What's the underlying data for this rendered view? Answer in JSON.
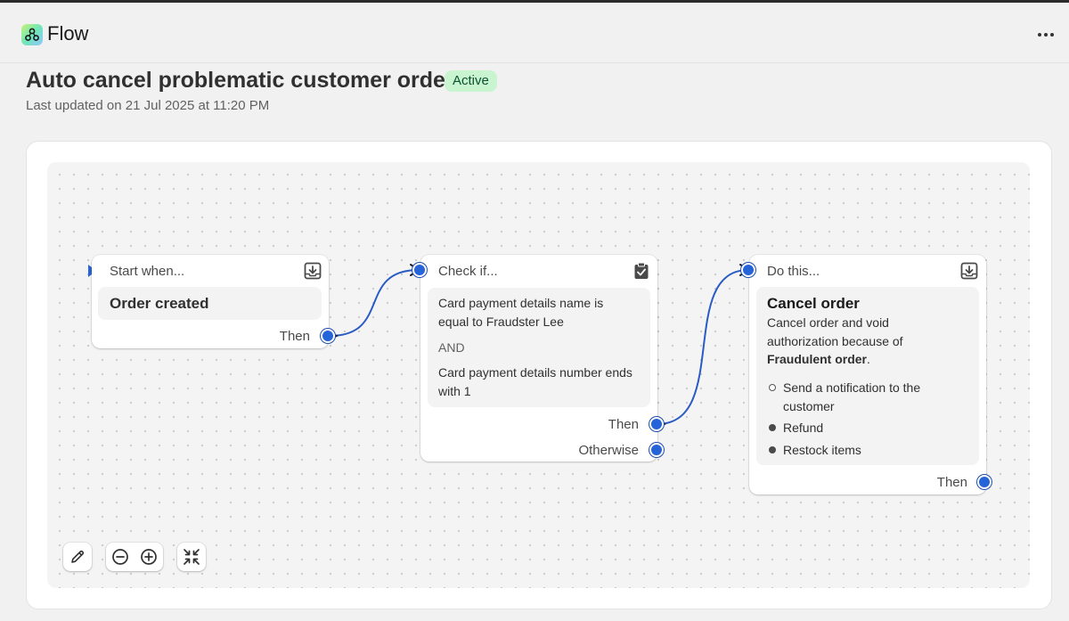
{
  "app": {
    "name": "Flow",
    "more_icon": "more-horizontal-icon"
  },
  "workflow": {
    "title": "Auto cancel problematic customer order",
    "status": "Active",
    "last_updated": "Last updated on 21 Jul 2025 at 11:20 PM"
  },
  "colors": {
    "accent": "#2563d9",
    "status_bg": "#c8f5cf",
    "status_text": "#0c5132"
  },
  "nodes": {
    "trigger": {
      "header": "Start when...",
      "icon": "download-tray-icon",
      "title": "Order created",
      "output_label": "Then"
    },
    "condition": {
      "header": "Check if...",
      "icon": "clipboard-check-icon",
      "line1a": "Card payment details name is",
      "line1b": "equal to Fraudster Lee",
      "operator": "AND",
      "line2a": "Card payment details number ends",
      "line2b": "with 1",
      "then_label": "Then",
      "otherwise_label": "Otherwise"
    },
    "action": {
      "header": "Do this...",
      "icon": "download-tray-icon",
      "title": "Cancel order",
      "desc_line1": "Cancel order and void",
      "desc_line2": "authorization because of",
      "desc_bold": "Fraudulent order",
      "desc_end": ".",
      "options": [
        {
          "line1": "Send a notification to the",
          "line2": "customer",
          "checked": false
        },
        {
          "line1": "Refund",
          "checked": true
        },
        {
          "line1": "Restock items",
          "checked": true
        }
      ],
      "output_label": "Then"
    }
  },
  "toolbar": {
    "edit_icon": "pencil-icon",
    "zoom_out_icon": "zoom-out-icon",
    "zoom_in_icon": "zoom-in-icon",
    "fit_icon": "fit-view-icon"
  }
}
